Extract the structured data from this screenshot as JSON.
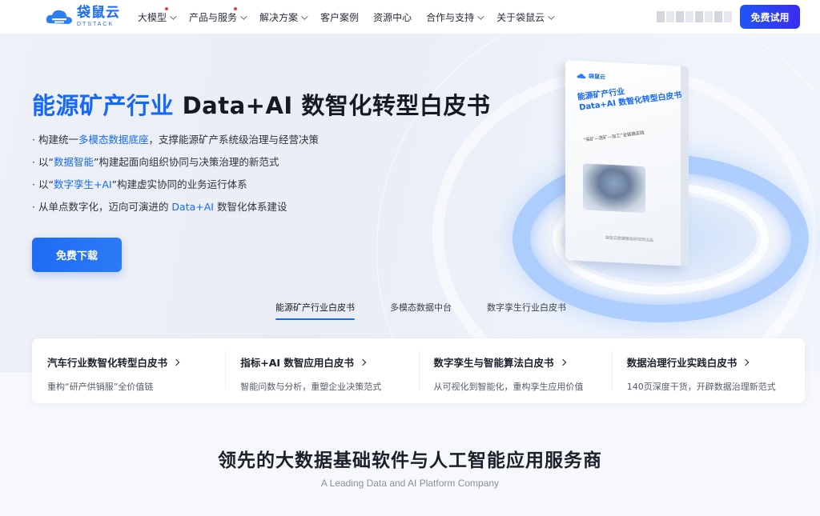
{
  "nav": {
    "logo_cn": "袋鼠云",
    "logo_en": "DTSTACK",
    "items": [
      {
        "label": "大模型",
        "dot": true,
        "chevron": true
      },
      {
        "label": "产品与服务",
        "dot": true,
        "chevron": true
      },
      {
        "label": "解决方案",
        "dot": false,
        "chevron": true
      },
      {
        "label": "客户案例",
        "dot": false,
        "chevron": false
      },
      {
        "label": "资源中心",
        "dot": false,
        "chevron": false
      },
      {
        "label": "合作与支持",
        "dot": false,
        "chevron": true
      },
      {
        "label": "关于袋鼠云",
        "dot": false,
        "chevron": true
      }
    ],
    "trial_label": "免费试用"
  },
  "hero": {
    "title_highlight": "能源矿产行业",
    "title_rest": " Data+AI 数智化转型白皮书",
    "bullets": [
      {
        "prefix": "· 构建统一",
        "bold": "多模态数据底座",
        "suffix": "，支撑能源矿产系统级治理与经营决策"
      },
      {
        "prefix": "· 以“",
        "bold": "数据智能",
        "suffix": "”构建起面向组织协同与决策治理的新范式"
      },
      {
        "prefix": "· 以“",
        "bold": "数字孪生+AI",
        "suffix": "”构建虚实协同的业务运行体系"
      },
      {
        "prefix": "· 从单点数字化，迈向可演进的 ",
        "bold": "Data+AI",
        "suffix": " 数智化体系建设"
      }
    ],
    "download_label": "免费下载",
    "book": {
      "logo": "袋鼠云",
      "title_line1": "能源矿产行业",
      "title_line2": "Data+AI 数智化转型白皮书",
      "subtitle": "“采矿—选矿—加工”全链路实践",
      "footer": "袋鼠云数据智能研究院出品"
    }
  },
  "tabs": [
    {
      "label": "能源矿产行业白皮书",
      "active": true
    },
    {
      "label": "多模态数据中台",
      "active": false
    },
    {
      "label": "数字孪生行业白皮书",
      "active": false
    }
  ],
  "cards": [
    {
      "title": "汽车行业数智化转型白皮书",
      "desc": "重构“研产供销服”全价值链"
    },
    {
      "title": "指标+AI 数智应用白皮书",
      "desc": "智能问数与分析，重塑企业决策范式"
    },
    {
      "title": "数字孪生与智能算法白皮书",
      "desc": "从可视化到智能化，重构孪生应用价值"
    },
    {
      "title": "数据治理行业实践白皮书",
      "desc": "140页深度干货，开辟数据治理新范式"
    }
  ],
  "section": {
    "title": "领先的大数据基础软件与人工智能应用服务商",
    "subtitle": "A Leading Data and AI Platform Company"
  },
  "colors": {
    "accent": "#1668f5",
    "nav_button": "#2156f5",
    "dot": "#f23a3a"
  }
}
